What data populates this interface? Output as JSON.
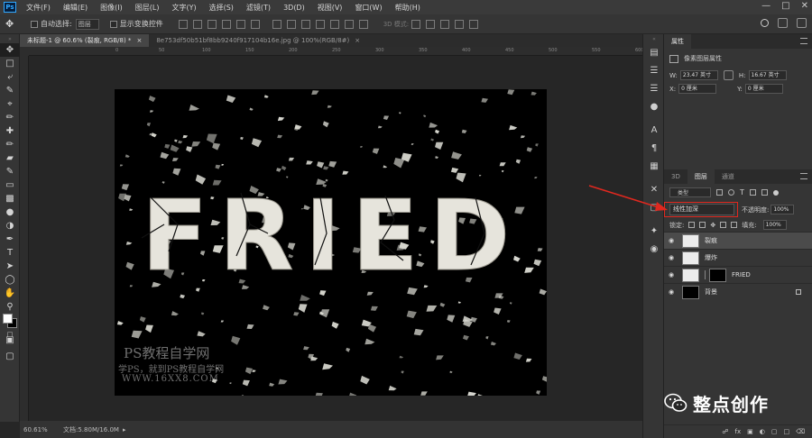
{
  "app": {
    "logo": "Ps"
  },
  "menu": [
    "文件(F)",
    "编辑(E)",
    "图像(I)",
    "图层(L)",
    "文字(Y)",
    "选择(S)",
    "滤镜(T)",
    "3D(D)",
    "视图(V)",
    "窗口(W)",
    "帮助(H)"
  ],
  "options": {
    "auto_select_label": "自动选择:",
    "auto_select_value": "图层",
    "show_transform_label": "显示变换控件",
    "mode_3d_label": "3D 模式:"
  },
  "tabs": [
    {
      "label": "未标题-1 @ 60.6% (裂痕, RGB/8) *",
      "close": "×"
    },
    {
      "label": "8e753df50b51bf8bb9240f917104b16e.jpg @ 100%(RGB/8#)",
      "close": "×"
    }
  ],
  "ruler_ticks": [
    "0",
    "50",
    "100",
    "150",
    "200",
    "250",
    "300",
    "350",
    "400",
    "450",
    "500",
    "550",
    "600",
    "650"
  ],
  "canvas": {
    "headline": "FRIED",
    "watermark_line1": "PS教程自学网",
    "watermark_line2": "学PS，就到PS教程自学网",
    "watermark_line3": "WWW.16XX8.COM"
  },
  "status": {
    "zoom": "60.61%",
    "doc": "文档:5.80M/16.0M"
  },
  "properties": {
    "tab": "属性",
    "heading": "像素图层属性",
    "w_label": "W:",
    "w_value": "23.47 英寸",
    "h_label": "H:",
    "h_value": "16.67 英寸",
    "x_label": "X:",
    "x_value": "0 厘米",
    "y_label": "Y:",
    "y_value": "0 厘米"
  },
  "layers_panel": {
    "tabs": [
      "3D",
      "图层",
      "通道"
    ],
    "filter_label": "类型",
    "blend_mode": "线性加深",
    "opacity_label": "不透明度:",
    "opacity_value": "100%",
    "lock_label": "锁定:",
    "fill_label": "填充:",
    "fill_value": "100%",
    "layers": [
      {
        "name": "裂痕",
        "selected": true
      },
      {
        "name": "爆炸",
        "selected": false
      },
      {
        "name": "FRIED",
        "selected": false
      },
      {
        "name": "背景",
        "selected": false
      }
    ],
    "footer_icons": [
      "link-icon",
      "fx-icon",
      "mask-icon",
      "adjustment-icon",
      "group-icon",
      "new-layer-icon",
      "trash-icon"
    ]
  },
  "brand": {
    "name": "整点创作"
  },
  "colors": {
    "highlight": "#e0281f",
    "ps_blue": "#31a8ff",
    "foreground": "#ffffff",
    "background": "#000000"
  }
}
